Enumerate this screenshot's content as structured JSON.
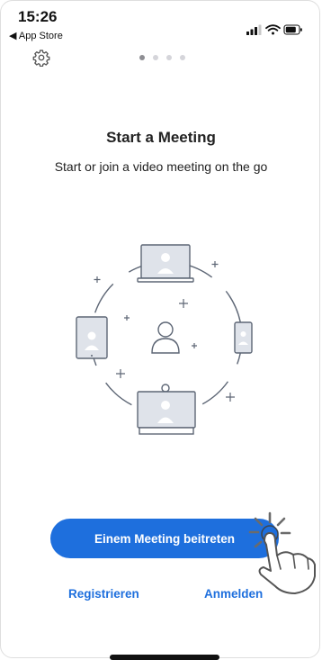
{
  "status_bar": {
    "time": "15:26",
    "back_label": "◀ App Store"
  },
  "pager": {
    "count": 4,
    "active_index": 0
  },
  "content": {
    "title": "Start a Meeting",
    "subtitle": "Start or join a video meeting on the go"
  },
  "actions": {
    "join_label": "Einem Meeting beitreten",
    "register_label": "Registrieren",
    "login_label": "Anmelden"
  },
  "colors": {
    "accent": "#1e6fdd",
    "illustration_line": "#5d6675",
    "illustration_fill": "#dfe3ea"
  },
  "icons": [
    "gear-icon",
    "signal-icon",
    "wifi-icon",
    "battery-icon",
    "tap-hand-icon"
  ]
}
